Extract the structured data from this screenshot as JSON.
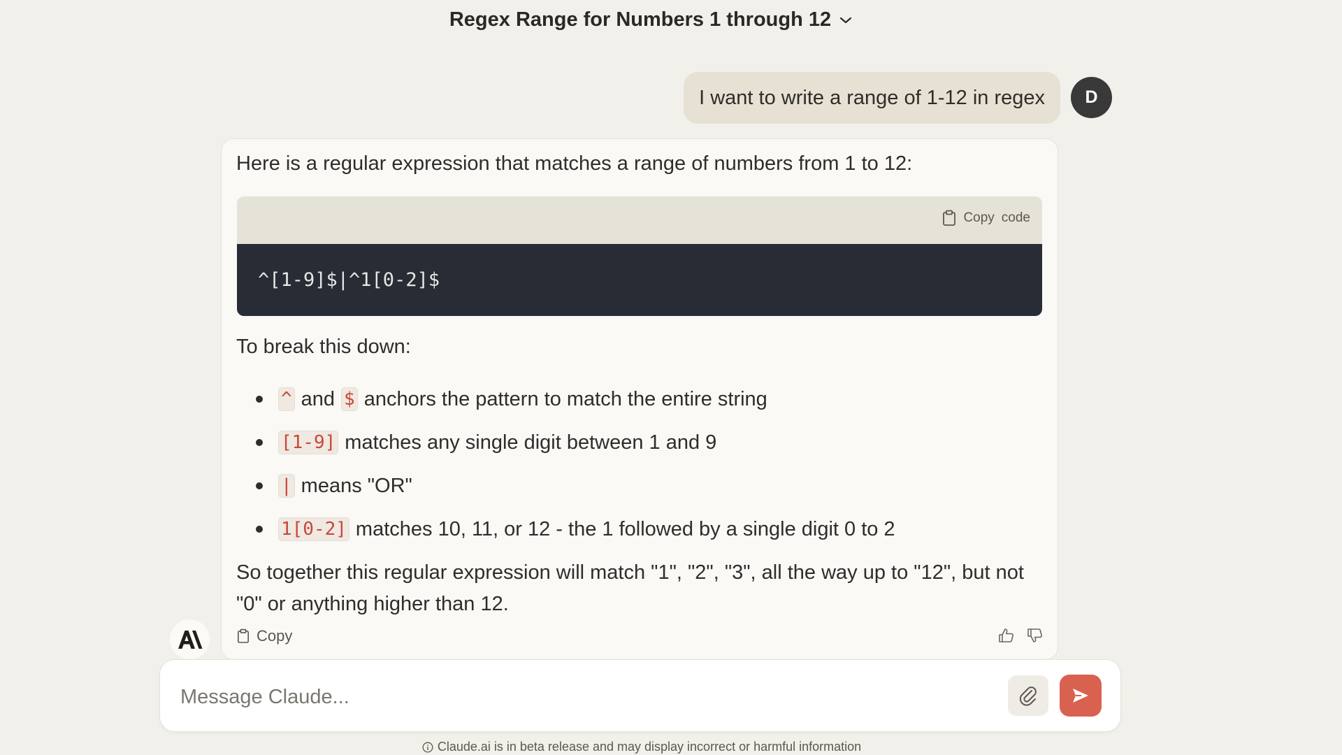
{
  "header": {
    "title": "Regex Range for Numbers 1 through 12"
  },
  "user": {
    "avatar_initial": "D",
    "message": "I want to write a range of 1-12 in regex"
  },
  "assistant": {
    "intro": "Here is a regular expression that matches a range of numbers from 1 to 12:",
    "code_block": {
      "copy_label": "Copy",
      "copy_label_2": "code",
      "code": "^[1-9]$|^1[0-2]$"
    },
    "breakdown_intro": "To break this down:",
    "bullets": [
      {
        "code": "^",
        "mid": "and",
        "code2": "$",
        "text": "anchors the pattern to match the entire string"
      },
      {
        "code": "[1-9]",
        "text": "matches any single digit between 1 and 9"
      },
      {
        "code": "|",
        "text": "means \"OR\""
      },
      {
        "code": "1[0-2]",
        "text": "matches 10, 11, or 12 - the 1 followed by a single digit 0 to 2"
      }
    ],
    "summary": "So together this regular expression will match \"1\", \"2\", \"3\", all the way up to \"12\", but not \"0\" or anything higher than 12.",
    "copy_label": "Copy"
  },
  "composer": {
    "placeholder": "Message Claude..."
  },
  "footer": {
    "disclaimer": "Claude.ai is in beta release and may display incorrect or harmful information"
  },
  "colors": {
    "background": "#f2f0ea",
    "send_button": "#d9614f",
    "inline_code": "#c9473a",
    "code_block_bg": "#282c34"
  },
  "icons": {
    "title_dropdown": "chevron-down-icon",
    "copy": "clipboard-icon",
    "feedback_positive": "thumbs-up-icon",
    "feedback_negative": "thumbs-down-icon",
    "attach": "paperclip-icon",
    "send": "send-arrow-icon",
    "info": "info-icon",
    "brand": "claude-logo-icon"
  }
}
